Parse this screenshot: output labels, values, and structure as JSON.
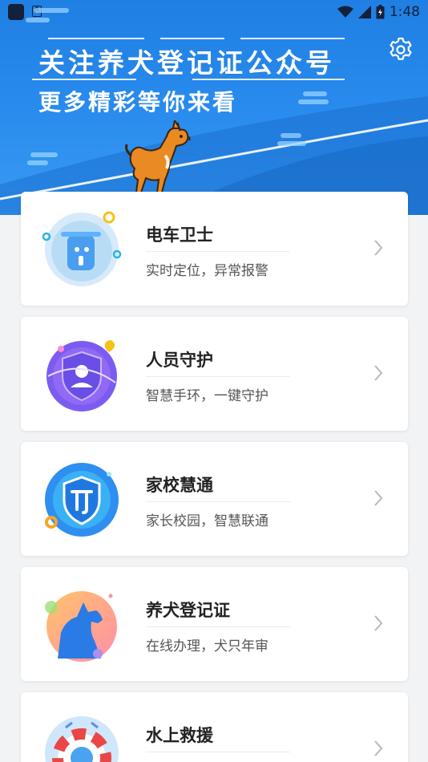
{
  "status_bar": {
    "time": "1:48",
    "wifi_icon": "wifi-icon",
    "signal_icon": "signal-icon",
    "battery_icon": "battery-icon"
  },
  "header": {
    "headline": "关注养犬登记证公众号",
    "subline": "更多精彩等你来看",
    "settings_icon": "gear-icon",
    "colors": {
      "banner_top": "#1f7fe3",
      "banner_bottom": "#3a9bf3"
    }
  },
  "cards": [
    {
      "title": "电车卫士",
      "subtitle": "实时定位，异常报警",
      "icon": "scooter-icon"
    },
    {
      "title": "人员守护",
      "subtitle": "智慧手环，一键守护",
      "icon": "person-shield-icon"
    },
    {
      "title": "家校慧通",
      "subtitle": "家长校园，智慧联通",
      "icon": "school-shield-icon"
    },
    {
      "title": "养犬登记证",
      "subtitle": "在线办理，犬只年审",
      "icon": "dog-icon"
    },
    {
      "title": "水上救援",
      "subtitle": "",
      "icon": "lifebuoy-icon"
    }
  ]
}
